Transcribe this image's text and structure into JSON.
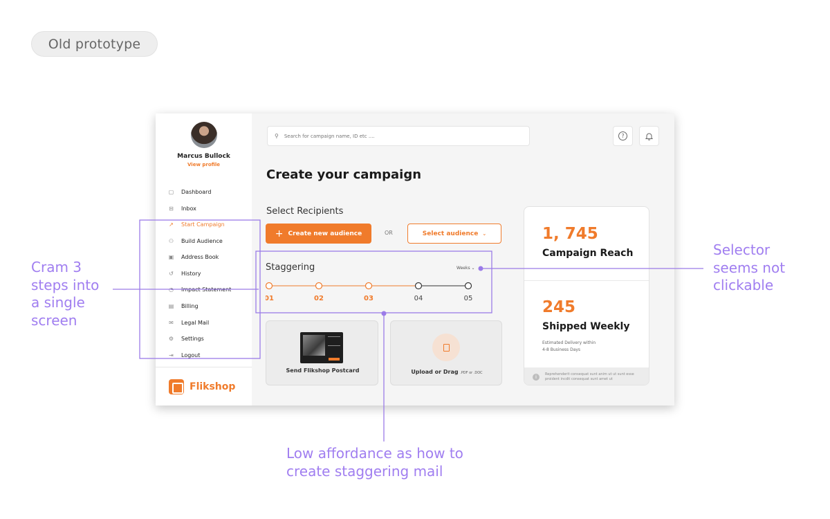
{
  "badge": "Old prototype",
  "profile": {
    "name": "Marcus Bullock",
    "link": "View profile"
  },
  "sidebar": {
    "items": [
      {
        "label": "Dashboard",
        "icon": "dashboard-icon",
        "glyph": "▢"
      },
      {
        "label": "Inbox",
        "icon": "inbox-icon",
        "glyph": "⊟"
      },
      {
        "label": "Start Campaign",
        "icon": "arrow-up-right-icon",
        "glyph": "↗",
        "active": true
      },
      {
        "label": "Build Audience",
        "icon": "users-icon",
        "glyph": "⚇"
      },
      {
        "label": "Address Book",
        "icon": "book-icon",
        "glyph": "▣"
      },
      {
        "label": "History",
        "icon": "history-icon",
        "glyph": "↺"
      },
      {
        "label": "Impact Statement",
        "icon": "pie-chart-icon",
        "glyph": "◔"
      },
      {
        "label": "Billing",
        "icon": "receipt-icon",
        "glyph": "▤"
      },
      {
        "label": "Legal Mail",
        "icon": "mail-icon",
        "glyph": "✉"
      },
      {
        "label": "Settings",
        "icon": "gear-icon",
        "glyph": "⚙"
      },
      {
        "label": "Logout",
        "icon": "logout-icon",
        "glyph": "⇥"
      }
    ],
    "logo": "Flikshop"
  },
  "search": {
    "placeholder": "Search for campaign name, ID etc ....",
    "icon": "search-icon"
  },
  "header_buttons": {
    "help_icon": "help-icon",
    "bell_icon": "bell-icon",
    "help_glyph": "?",
    "bell_glyph": "🔔"
  },
  "main": {
    "title": "Create your campaign",
    "recipients_label": "Select Recipients",
    "create_button": "Create new audience",
    "plus": "+",
    "or": "OR",
    "select_button": "Select audience",
    "select_chevron": "⌄",
    "staggering_title": "Staggering",
    "weeks_selector": "Weeks ⌄",
    "steps": [
      "01",
      "02",
      "03",
      "04",
      "05"
    ],
    "steps_active": 3,
    "postcard_label": "Send Flikshop Postcard",
    "upload_label": "Upload or Drag",
    "upload_formats": ".PDF or .DOC"
  },
  "stats": {
    "reach_value": "1, 745",
    "reach_label": "Campaign Reach",
    "shipped_value": "245",
    "shipped_label": "Shipped Weekly",
    "shipped_sub_1": "Estimated Delivery within",
    "shipped_sub_2": "4-8 Business Days",
    "footer_text": "Reprehenderit consequat sunt anim ut ut sunt esse proident incdit consequat sunt amet ut",
    "info_glyph": "i"
  },
  "annotations": {
    "left": [
      "Cram 3",
      "steps into",
      "a single",
      "screen"
    ],
    "right": [
      "Selector",
      "seems not",
      "clickable"
    ],
    "bottom": [
      "Low affordance as how to",
      "create staggering mail"
    ]
  },
  "colors": {
    "accent": "#f07b2b",
    "annotation": "#a07ef0",
    "annotation_line": "#9b7be8"
  }
}
